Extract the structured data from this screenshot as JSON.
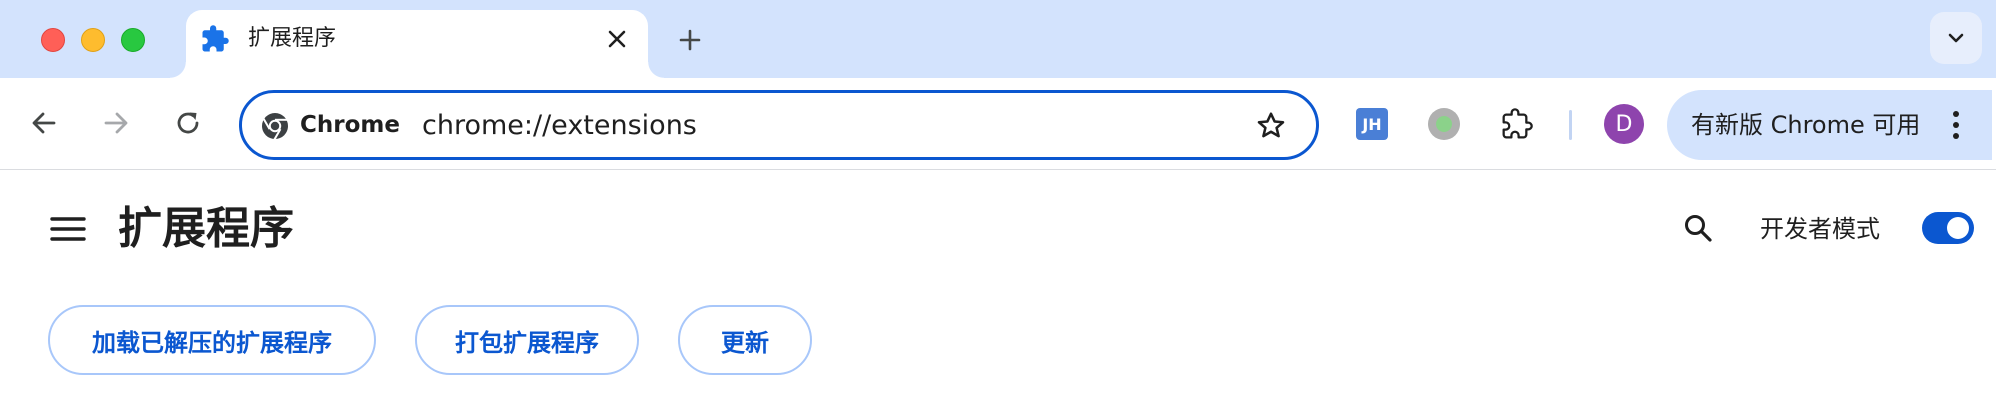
{
  "window": {
    "tab_title": "扩展程序",
    "icons": {
      "close": "close-window-icon",
      "minimize": "minimize-window-icon",
      "maximize": "maximize-window-icon"
    }
  },
  "tab": {
    "title": "扩展程序",
    "icon": "puzzle-icon",
    "close_icon": "close-icon"
  },
  "tabstrip": {
    "new_tab_icon": "plus-icon",
    "tab_search_icon": "chevron-down-icon"
  },
  "toolbar": {
    "back_icon": "arrow-left-icon",
    "forward_icon": "arrow-right-icon",
    "reload_icon": "reload-icon",
    "omnibox": {
      "chip_label": "Chrome",
      "url": "chrome://extensions",
      "bookmark_icon": "star-icon"
    },
    "extensions": [
      {
        "name": "jh-extension-icon",
        "label": "JH"
      },
      {
        "name": "green-dot-extension-icon"
      }
    ],
    "extensions_menu_icon": "puzzle-icon",
    "profile_initial": "D",
    "update_label": "有新版 Chrome 可用",
    "menu_icon": "more-vertical-icon"
  },
  "page": {
    "title": "扩展程序",
    "menu_icon": "hamburger-icon",
    "search_icon": "search-icon",
    "developer_mode_label": "开发者模式",
    "developer_mode_on": true,
    "buttons": {
      "load_unpacked": "加载已解压的扩展程序",
      "pack": "打包扩展程序",
      "update": "更新"
    }
  },
  "colors": {
    "accent": "#0b57d0",
    "tabstrip_bg": "#d3e3fd",
    "button_border": "#a8c7fa"
  }
}
